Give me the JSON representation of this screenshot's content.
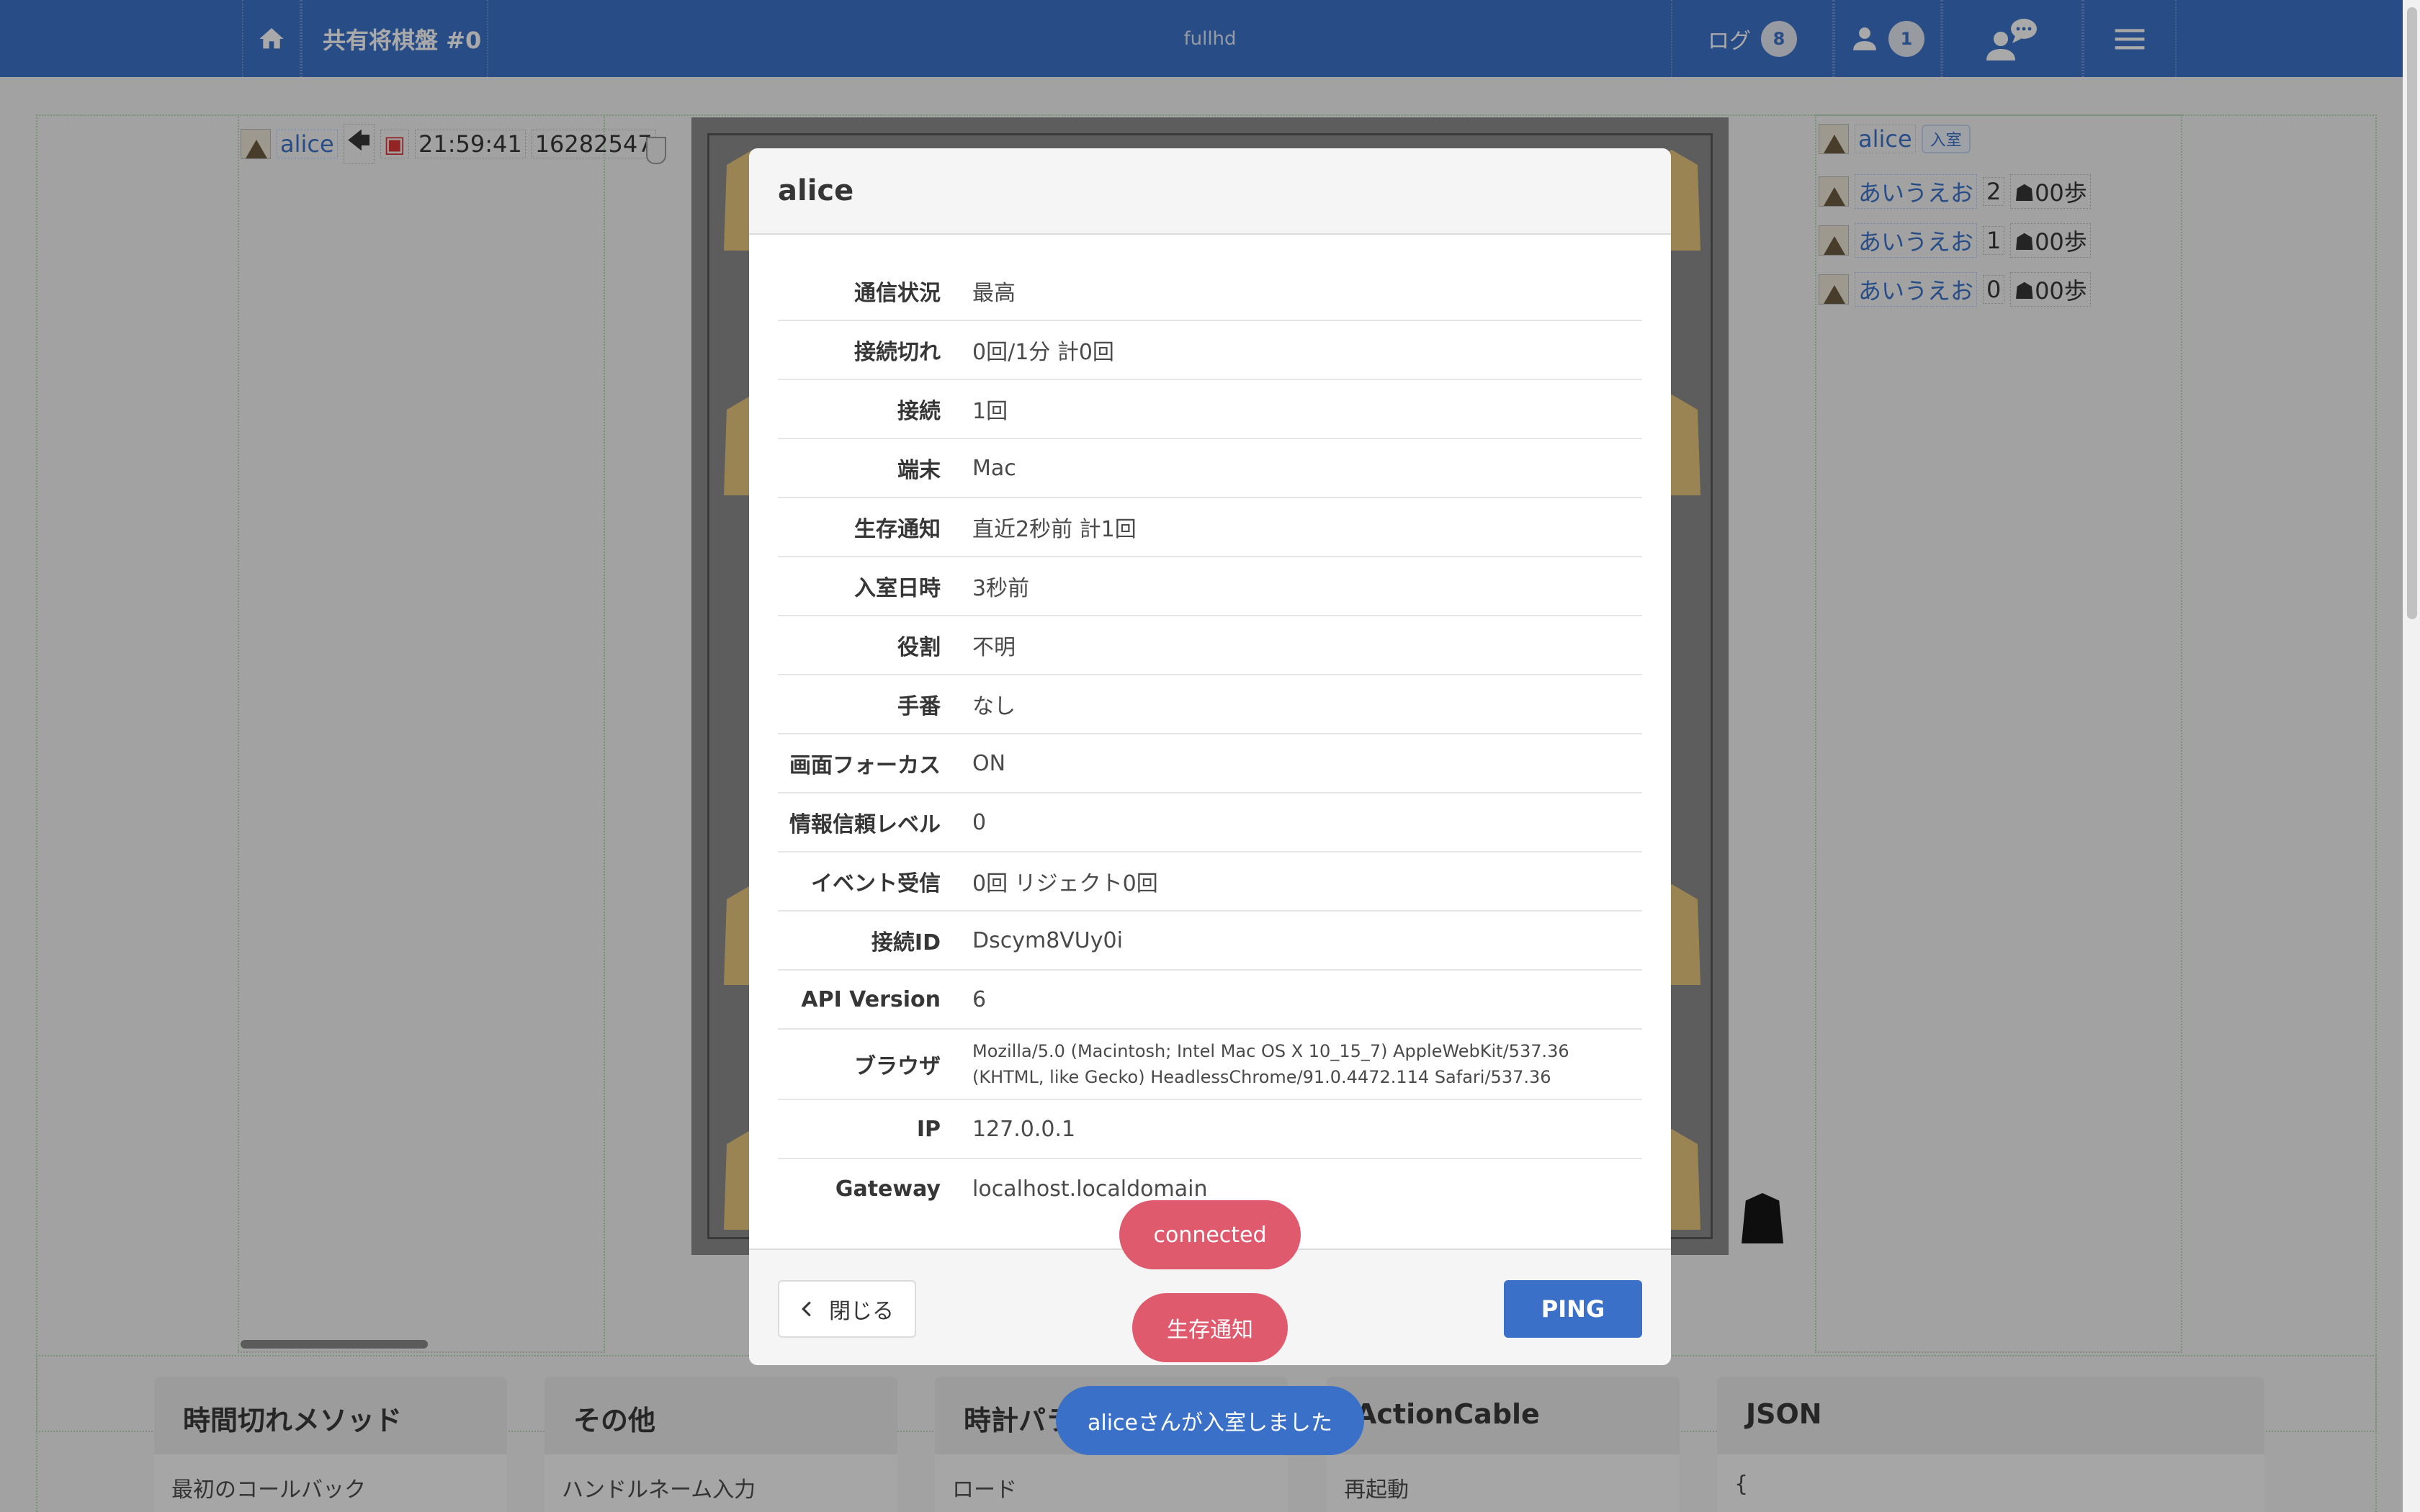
{
  "navbar": {
    "title": "共有将棋盤 #0",
    "center": "fullhd",
    "log_label": "ログ",
    "log_count": "8",
    "member_count": "1"
  },
  "left_player": {
    "name": "alice",
    "time": "21:59:41",
    "id": "16282547"
  },
  "right_list": {
    "head_name": "alice",
    "head_tag": "入室",
    "members": [
      {
        "name": "あいうえお",
        "num": "2",
        "pawns": "00歩"
      },
      {
        "name": "あいうえお",
        "num": "1",
        "pawns": "00歩"
      },
      {
        "name": "あいうえお",
        "num": "0",
        "pawns": "00歩"
      }
    ]
  },
  "modal": {
    "title": "alice",
    "rows": [
      {
        "k": "通信状況",
        "v": "最高"
      },
      {
        "k": "接続切れ",
        "v": "0回/1分 計0回"
      },
      {
        "k": "接続",
        "v": "1回"
      },
      {
        "k": "端末",
        "v": "Mac"
      },
      {
        "k": "生存通知",
        "v": "直近2秒前 計1回"
      },
      {
        "k": "入室日時",
        "v": "3秒前"
      },
      {
        "k": "役割",
        "v": "不明"
      },
      {
        "k": "手番",
        "v": "なし"
      },
      {
        "k": "画面フォーカス",
        "v": "ON"
      },
      {
        "k": "情報信頼レベル",
        "v": "0"
      },
      {
        "k": "イベント受信",
        "v": "0回 リジェクト0回"
      },
      {
        "k": "接続ID",
        "v": "Dscym8VUy0i"
      },
      {
        "k": "API Version",
        "v": "6"
      },
      {
        "k": "ブラウザ",
        "v": "Mozilla/5.0 (Macintosh; Intel Mac OS X 10_15_7) AppleWebKit/537.36 (KHTML, like Gecko) HeadlessChrome/91.0.4472.114 Safari/537.36"
      },
      {
        "k": "IP",
        "v": "127.0.0.1"
      },
      {
        "k": "Gateway",
        "v": "localhost.localdomain"
      }
    ],
    "close_label": "閉じる",
    "ping_label": "PING"
  },
  "toasts": {
    "connected": "connected",
    "alive": "生存通知",
    "joined": "aliceさんが入室しました"
  },
  "panels": [
    {
      "head": "時間切れメソッド",
      "body": "最初のコールバック"
    },
    {
      "head": "その他",
      "body": "ハンドルネーム入力"
    },
    {
      "head": "時計パラ",
      "body": "ロード"
    },
    {
      "head": "ActionCable",
      "body": "再起動"
    },
    {
      "head": "JSON",
      "body": "{"
    }
  ]
}
